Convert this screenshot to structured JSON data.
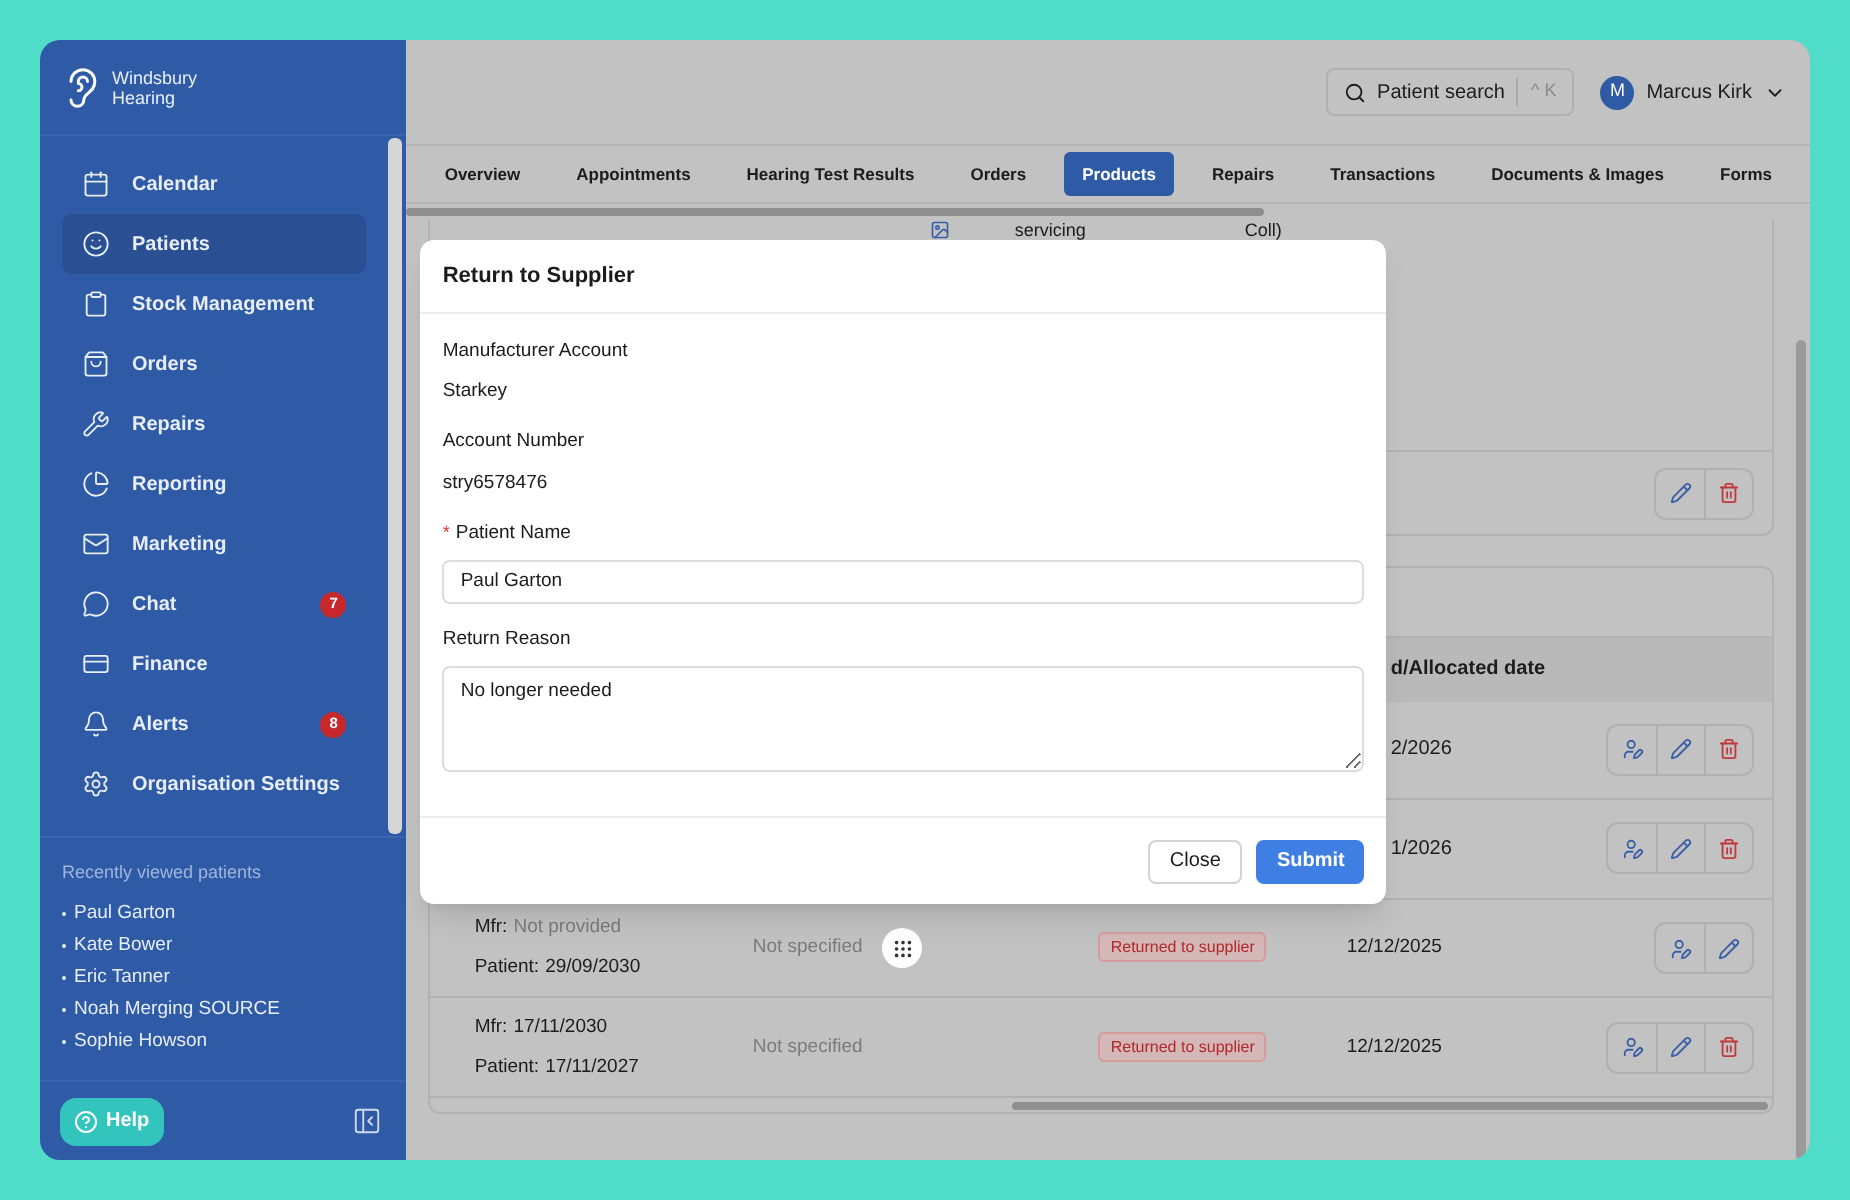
{
  "brand": {
    "line1": "Windsbury",
    "line2": "Hearing"
  },
  "nav": [
    {
      "label": "Calendar",
      "selected": false
    },
    {
      "label": "Patients",
      "selected": true
    },
    {
      "label": "Stock Management",
      "selected": false
    },
    {
      "label": "Orders",
      "selected": false
    },
    {
      "label": "Repairs",
      "selected": false
    },
    {
      "label": "Reporting",
      "selected": false
    },
    {
      "label": "Marketing",
      "selected": false
    },
    {
      "label": "Chat",
      "selected": false,
      "badge": "7"
    },
    {
      "label": "Finance",
      "selected": false
    },
    {
      "label": "Alerts",
      "selected": false,
      "badge": "8"
    },
    {
      "label": "Organisation Settings",
      "selected": false
    }
  ],
  "recent": {
    "title": "Recently viewed patients",
    "items": [
      "Paul Garton",
      "Kate Bower",
      "Eric Tanner",
      "Noah Merging SOURCE",
      "Sophie Howson"
    ]
  },
  "help": "Help",
  "header": {
    "search": "Patient search",
    "shortcut": "^ K",
    "avatar": "M",
    "user": "Marcus Kirk"
  },
  "tabs": [
    {
      "label": "Overview",
      "selected": false
    },
    {
      "label": "Appointments",
      "selected": false
    },
    {
      "label": "Hearing Test Results",
      "selected": false
    },
    {
      "label": "Orders",
      "selected": false
    },
    {
      "label": "Products",
      "selected": true
    },
    {
      "label": "Repairs",
      "selected": false
    },
    {
      "label": "Transactions",
      "selected": false
    },
    {
      "label": "Documents & Images",
      "selected": false
    },
    {
      "label": "Forms",
      "selected": false
    }
  ],
  "product_card": {
    "cells": [
      "servicing",
      "Coll)"
    ],
    "deletable": true
  },
  "table": {
    "header": "d/Allocated date",
    "rows": [
      {
        "kind": "partial",
        "date": "2/2026",
        "deletable": true
      },
      {
        "kind": "partial",
        "date": "1/2026",
        "deletable": true
      },
      {
        "kind": "full",
        "mfr_label": "Mfr:",
        "mfr": "Not provided",
        "mfr_missing": true,
        "patient_label": "Patient:",
        "patient": "29/09/2030",
        "serial": "Not specified",
        "status": "Returned to supplier",
        "date": "12/12/2025",
        "deletable": false
      },
      {
        "kind": "full",
        "mfr_label": "Mfr:",
        "mfr": "17/11/2030",
        "mfr_missing": false,
        "patient_label": "Patient:",
        "patient": "17/11/2027",
        "serial": "Not specified",
        "status": "Returned to supplier",
        "date": "12/12/2025",
        "deletable": true
      }
    ]
  },
  "modal": {
    "title": "Return to Supplier",
    "fields": [
      {
        "kind": "static",
        "label": "Manufacturer Account",
        "value": "Starkey"
      },
      {
        "kind": "static",
        "label": "Account Number",
        "value": "stry6578476"
      },
      {
        "kind": "input",
        "label": "Patient Name",
        "value": "Paul Garton",
        "required_mark": "*"
      },
      {
        "kind": "textarea",
        "label": "Return Reason",
        "value": "No longer needed"
      }
    ],
    "buttons": [
      {
        "label": "Close",
        "kind": "secondary"
      },
      {
        "label": "Submit",
        "kind": "primary"
      }
    ]
  }
}
